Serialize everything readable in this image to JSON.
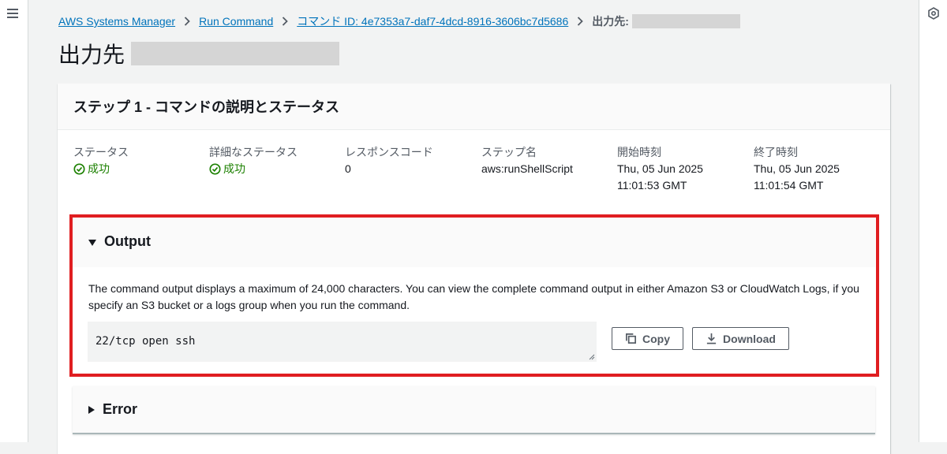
{
  "breadcrumb": {
    "items": [
      "AWS Systems Manager",
      "Run Command",
      "コマンド ID: 4e7353a7-daf7-4dcd-8916-3606bc7d5686"
    ],
    "current_prefix": "出力先:"
  },
  "page": {
    "title": "出力先"
  },
  "step": {
    "header": "ステップ 1 - コマンドの説明とステータス",
    "columns": [
      {
        "label": "ステータス",
        "value": "成功",
        "status": true
      },
      {
        "label": "詳細なステータス",
        "value": "成功",
        "status": true
      },
      {
        "label": "レスポンスコード",
        "value": "0"
      },
      {
        "label": "ステップ名",
        "value": "aws:runShellScript"
      },
      {
        "label": "開始時刻",
        "value": "Thu, 05 Jun 2025",
        "value2": "11:01:53 GMT"
      },
      {
        "label": "終了時刻",
        "value": "Thu, 05 Jun 2025",
        "value2": "11:01:54 GMT"
      }
    ]
  },
  "output": {
    "title": "Output",
    "description": "The command output displays a maximum of 24,000 characters. You can view the complete command output in either Amazon S3 or CloudWatch Logs, if you specify an S3 bucket or a logs group when you run the command.",
    "content": "22/tcp open ssh",
    "copy_label": "Copy",
    "download_label": "Download"
  },
  "error": {
    "title": "Error"
  },
  "colors": {
    "link": "#0073bb",
    "success": "#1d8102",
    "highlight": "#e01e21"
  },
  "icons": [
    "menu-icon",
    "settings-hex-icon",
    "chevron-right-icon",
    "check-circle-icon",
    "caret-down-icon",
    "caret-right-icon",
    "copy-icon",
    "download-icon"
  ]
}
